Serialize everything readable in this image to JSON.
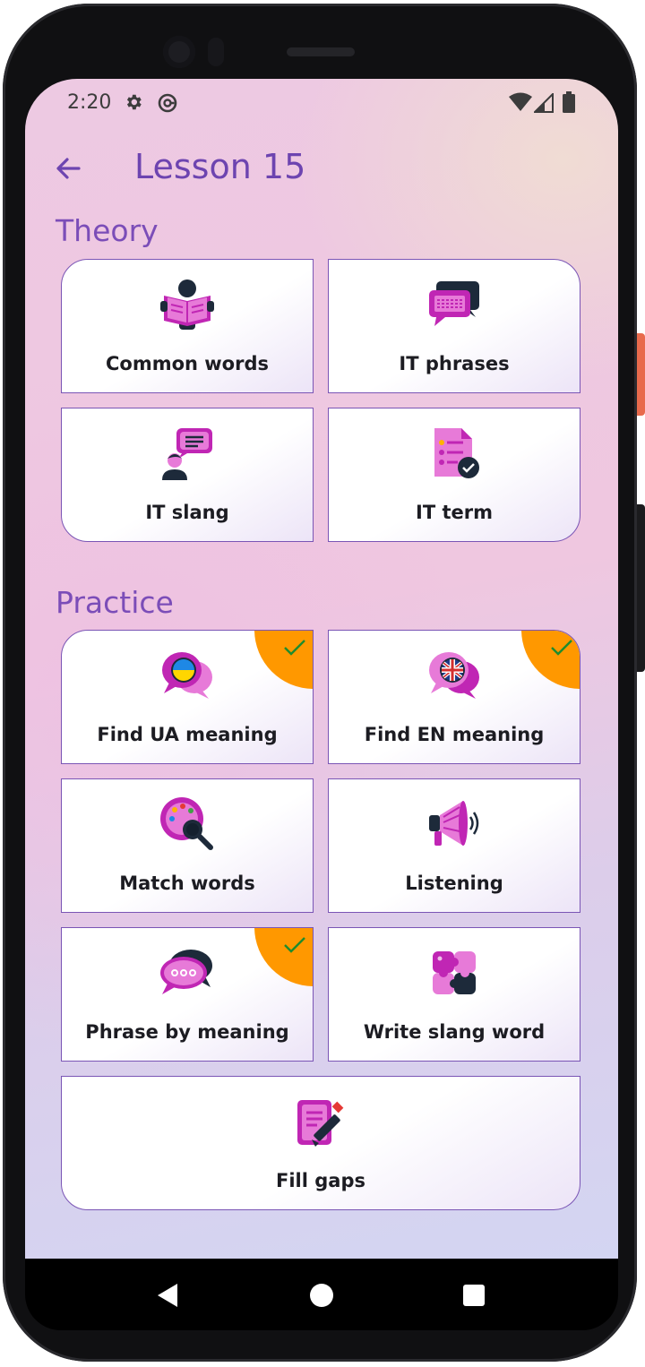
{
  "status_bar": {
    "time": "2:20",
    "icons": [
      "gear-icon",
      "sync-icon",
      "wifi-icon",
      "signal-icon",
      "battery-icon"
    ]
  },
  "header": {
    "back_icon": "arrow-left-icon",
    "title": "Lesson 15"
  },
  "theory": {
    "heading": "Theory",
    "cards": [
      {
        "label": "Common words",
        "icon": "reading-book-icon"
      },
      {
        "label": "IT phrases",
        "icon": "chat-keyboard-icon"
      },
      {
        "label": "IT slang",
        "icon": "person-chat-icon"
      },
      {
        "label": "IT term",
        "icon": "document-check-icon"
      }
    ]
  },
  "practice": {
    "heading": "Practice",
    "cards": [
      {
        "label": "Find UA meaning",
        "icon": "ukraine-flag-chat-icon",
        "completed": true
      },
      {
        "label": "Find EN meaning",
        "icon": "uk-flag-chat-icon",
        "completed": true
      },
      {
        "label": "Match words",
        "icon": "palette-magnifier-icon",
        "completed": false
      },
      {
        "label": "Listening",
        "icon": "megaphone-icon",
        "completed": false
      },
      {
        "label": "Phrase by meaning",
        "icon": "chat-bubbles-icon",
        "completed": true
      },
      {
        "label": "Write slang word",
        "icon": "puzzle-icon",
        "completed": false
      },
      {
        "label": "Fill gaps",
        "icon": "notepad-pencil-icon",
        "completed": false
      }
    ]
  },
  "colors": {
    "accent": "#7b4db8",
    "completed_badge": "#ff9800",
    "check": "#1e8c2e"
  },
  "nav_bar": {
    "icons": [
      "nav-back-icon",
      "nav-home-icon",
      "nav-recents-icon"
    ]
  }
}
